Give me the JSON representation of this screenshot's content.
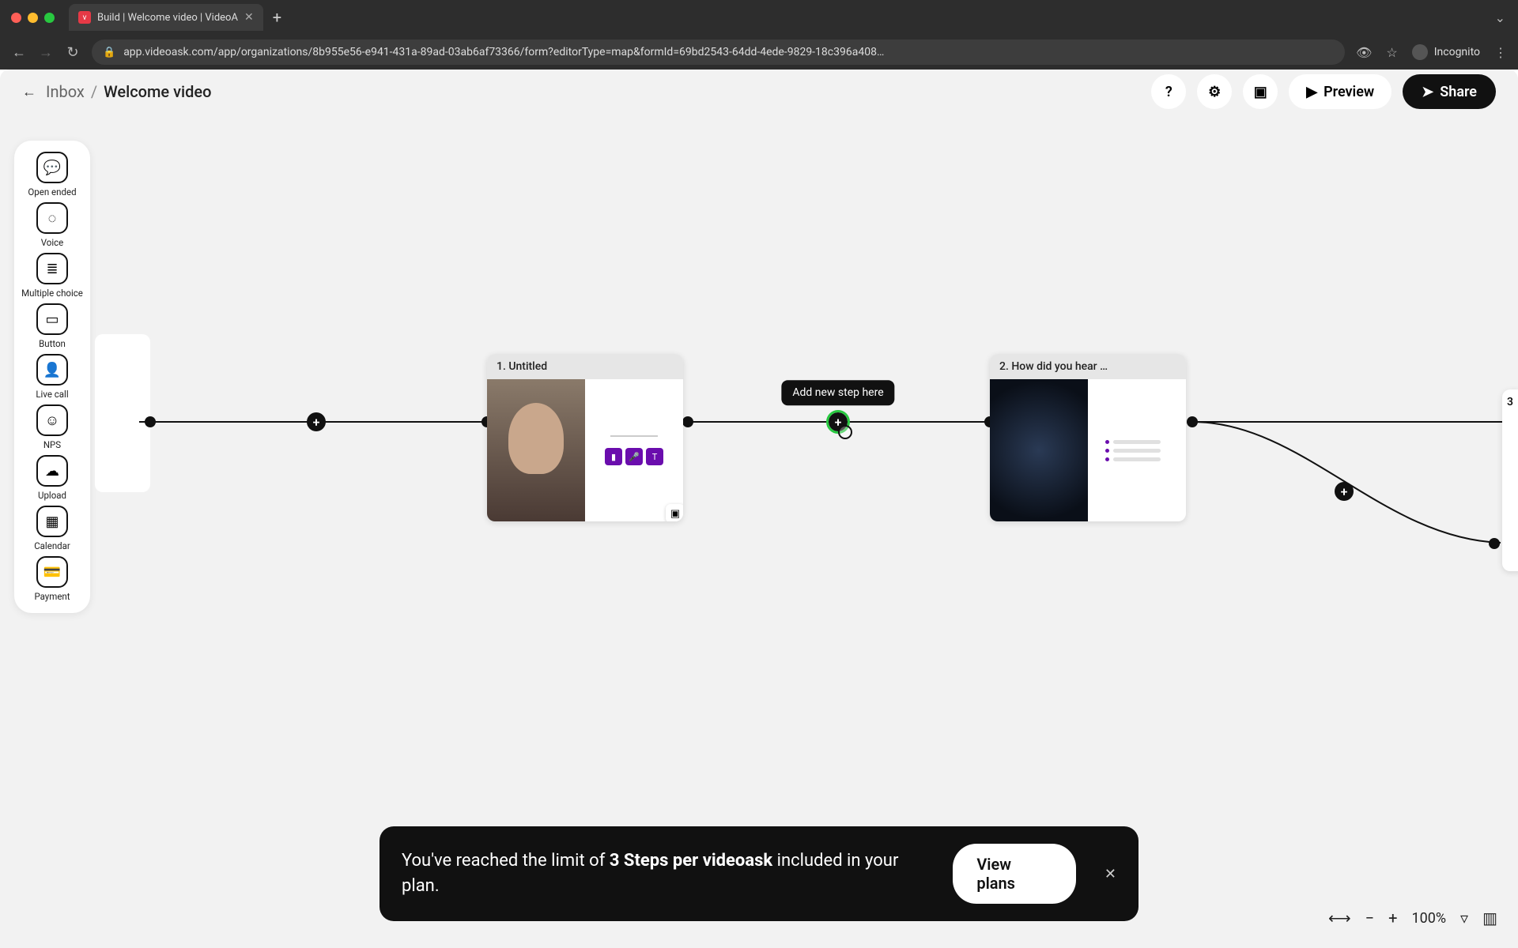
{
  "browser": {
    "tab_title": "Build | Welcome video | VideoA",
    "url": "app.videoask.com/app/organizations/8b955e56-e941-431a-89ad-03ab6af73366/form?editorType=map&formId=69bd2543-64dd-4ede-9829-18c396a408…",
    "profile": "Incognito"
  },
  "header": {
    "back_to": "Inbox",
    "title": "Welcome video",
    "help_icon": "?",
    "preview": "Preview",
    "share": "Share"
  },
  "toolbar": [
    {
      "label": "Open ended",
      "icon": "💬"
    },
    {
      "label": "Voice",
      "icon": "◌"
    },
    {
      "label": "Multiple choice",
      "icon": "≣"
    },
    {
      "label": "Button",
      "icon": "▭"
    },
    {
      "label": "Live call",
      "icon": "👤"
    },
    {
      "label": "NPS",
      "icon": "☺"
    },
    {
      "label": "Upload",
      "icon": "☁"
    },
    {
      "label": "Calendar",
      "icon": "▦"
    },
    {
      "label": "Payment",
      "icon": "💳"
    }
  ],
  "canvas": {
    "tooltip": "Add new step here",
    "card1_title": "1. Untitled",
    "card2_title": "2. How did you hear …",
    "card3_num": "3"
  },
  "banner": {
    "prefix": "You've reached the limit of ",
    "bold1": "3 Steps per videoask",
    "suffix": " included in your plan.",
    "cta": "View plans"
  },
  "zoom": {
    "pct": "100%"
  }
}
